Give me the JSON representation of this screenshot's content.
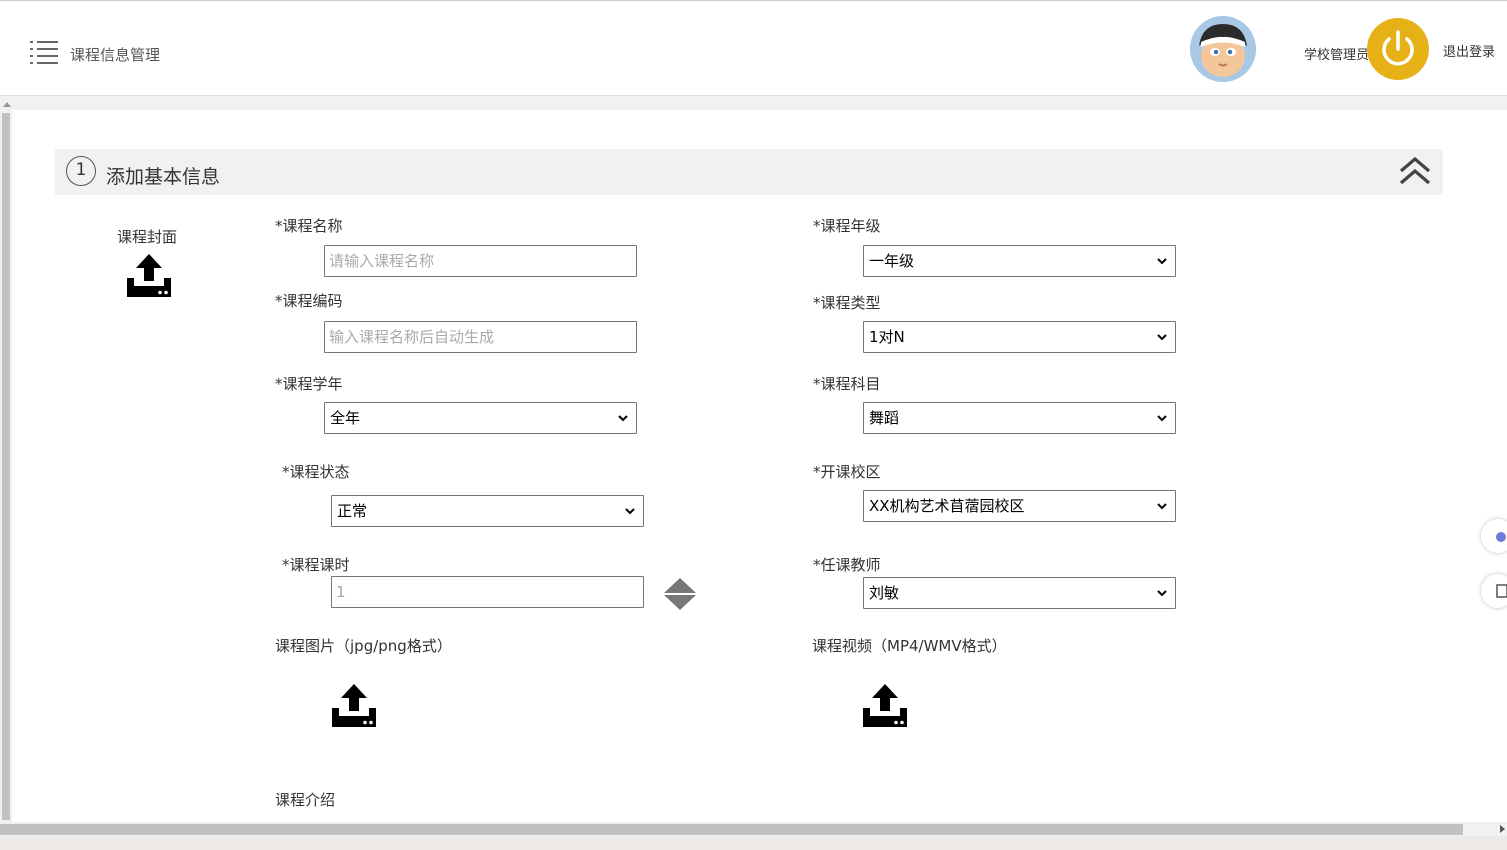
{
  "header": {
    "page_title": "课程信息管理",
    "user_role": "学校管理员",
    "logout_label": "退出登录"
  },
  "section": {
    "step_number": "1",
    "title": "添加基本信息"
  },
  "form": {
    "cover_label": "课程封面",
    "course_name": {
      "label": "*课程名称",
      "placeholder": "请输入课程名称"
    },
    "course_code": {
      "label": "*课程编码",
      "placeholder": "输入课程名称后自动生成"
    },
    "course_year": {
      "label": "*课程学年",
      "value": "全年"
    },
    "course_status": {
      "label": "*课程状态",
      "value": "正常"
    },
    "course_hours": {
      "label": "*课程课时",
      "value": "1"
    },
    "course_grade": {
      "label": "*课程年级",
      "value": "一年级"
    },
    "course_type": {
      "label": "*课程类型",
      "value": "1对N"
    },
    "course_subject": {
      "label": "*课程科目",
      "value": "舞蹈"
    },
    "campus": {
      "label": "*开课校区",
      "value": "XX机构艺术苜蓿园校区"
    },
    "teacher": {
      "label": "*任课教师",
      "value": "刘敏"
    },
    "image_label": "课程图片（jpg/png格式）",
    "video_label": "课程视频（MP4/WMV格式）",
    "intro_label": "课程介绍"
  },
  "colors": {
    "accent": "#e6b117",
    "section_bg": "#f1f1f1",
    "avatar_bg": "#a9c8e6"
  },
  "icons": {
    "menu": "menu-icon",
    "power": "power-icon",
    "collapse": "double-chevron-up-icon",
    "upload": "upload-icon",
    "stepper": "stepper-arrows-icon"
  }
}
